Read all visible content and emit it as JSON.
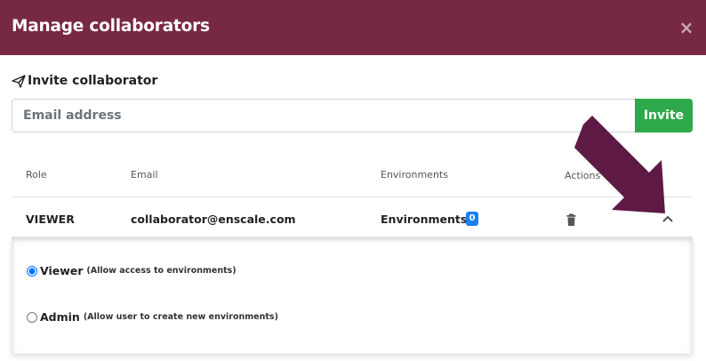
{
  "modal": {
    "title": "Manage collaborators",
    "close_label": "×"
  },
  "invite": {
    "heading": "Invite collaborator",
    "email_placeholder": "Email address",
    "email_value": "",
    "button_label": "Invite"
  },
  "table": {
    "columns": [
      "Role",
      "Email",
      "Environments",
      "Actions"
    ],
    "rows": [
      {
        "role": "VIEWER",
        "email": "collaborator@enscale.com",
        "environments_label": "Environments",
        "environments_count": "0",
        "actions": [
          "trash-icon",
          "chevron-up-icon"
        ]
      }
    ]
  },
  "role_options": [
    {
      "label": "Viewer",
      "description": "(Allow access to environments)",
      "selected": true
    },
    {
      "label": "Admin",
      "description": "(Allow user to create new environments)",
      "selected": false
    }
  ],
  "colors": {
    "header": "#782942",
    "invite_button": "#2ea84a",
    "badge": "#1a7ff0",
    "annotation_arrow": "#5e1a45"
  }
}
